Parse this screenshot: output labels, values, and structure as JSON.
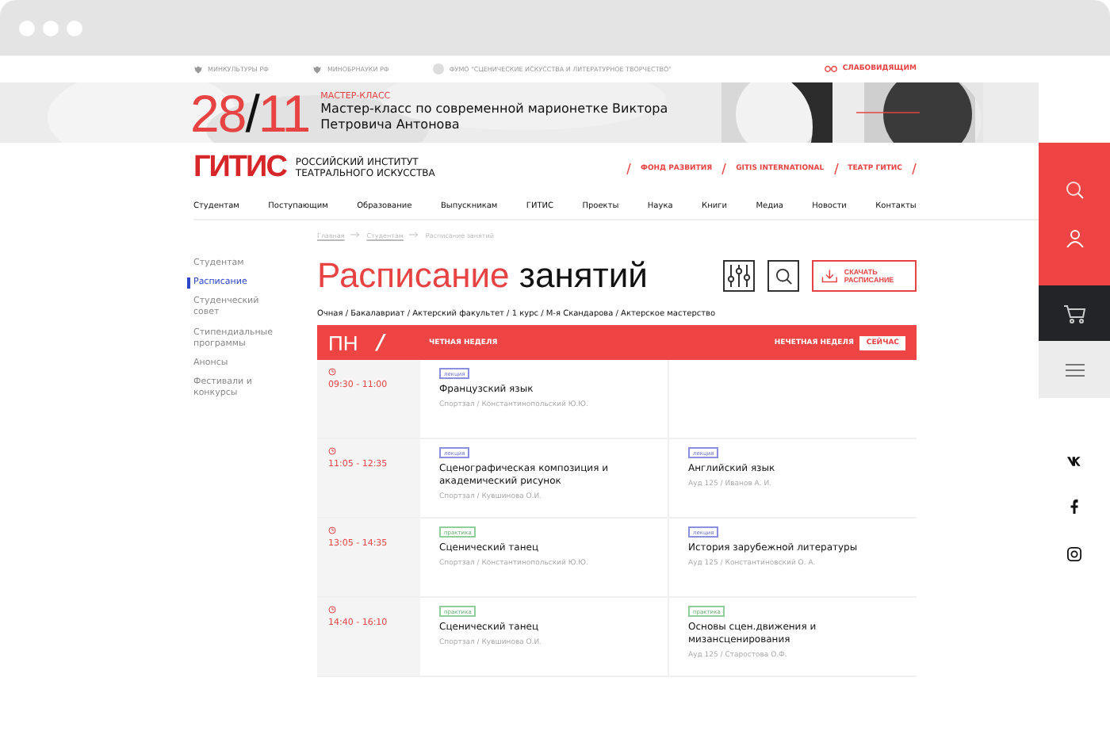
{
  "top_links": [
    "МИНКУЛЬТУРЫ РФ",
    "МИНОБРНАУКИ РФ",
    "ФУМО \"СЦЕНИЧЕСКИЕ ИСКУССТВА И ЛИТЕРАТУРНОЕ ТВОРЧЕСТВО\""
  ],
  "accessibility_link": "СЛАБОВИДЯЩИМ",
  "banner": {
    "day": "28",
    "slash": "/",
    "month": "11",
    "kicker": "МАСТЕР-КЛАСС",
    "title": "Мастер-класс по современной марионетке Виктора Петровича Антонова"
  },
  "logo": {
    "mark": "ГИТИС",
    "name": "РОССИЙСКИЙ ИНСТИТУТ ТЕАТРАЛЬНОГО ИСКУССТВА"
  },
  "header_links": [
    "ФОНД РАЗВИТИЯ",
    "GITIS INTERNATIONAL",
    "ТЕАТР ГИТИС"
  ],
  "nav": [
    "Студентам",
    "Поступающим",
    "Образование",
    "Выпускникам",
    "ГИТИС",
    "Проекты",
    "Наука",
    "Книги",
    "Медиа",
    "Новости",
    "Контакты"
  ],
  "breadcrumbs": [
    "Главная",
    "Студентам",
    "Расписание занятий"
  ],
  "sidebar": [
    {
      "label": "Студентам",
      "selected": false
    },
    {
      "label": "Расписание",
      "selected": true
    },
    {
      "label": "Студенческий совет",
      "selected": false
    },
    {
      "label": "Стипендиальные программы",
      "selected": false
    },
    {
      "label": "Анонсы",
      "selected": false
    },
    {
      "label": "Фестивали и конкурсы",
      "selected": false
    }
  ],
  "title": {
    "accent": "Расписание",
    "rest": "занятий"
  },
  "download_button": "СКАЧАТЬ РАСПИСАНИЕ",
  "filter_path": "Очная / Бакалавриат / Актерский факультет / 1 курс / М-я Скандарова / Актерское мастерство",
  "day_bar": {
    "day": "ПН",
    "slash": "/",
    "even_week": "ЧЕТНАЯ НЕДЕЛЯ",
    "odd_week": "НЕЧЕТНАЯ НЕДЕЛЯ",
    "now_badge": "СЕЙЧАС"
  },
  "rows": [
    {
      "time": "09:30 - 11:00",
      "even": {
        "kind": "lecture",
        "tag": "лекция",
        "title": "Французский язык",
        "meta": "Спортзал / Константинопольский Ю.Ю."
      }
    },
    {
      "time": "11:05 - 12:35",
      "even": {
        "kind": "lecture",
        "tag": "лекция",
        "title": "Сценографическая композиция и академический рисунок",
        "meta": "Спортзал / Кувшинова О.И."
      },
      "odd": {
        "kind": "lecture",
        "tag": "лекция",
        "title": "Английский язык",
        "meta": "Ауд 125 / Иванов А. И."
      }
    },
    {
      "time": "13:05 - 14:35",
      "even": {
        "kind": "practice",
        "tag": "практика",
        "title": "Сценический  танец",
        "meta": "Спортзал / Константинопольский Ю.Ю."
      },
      "odd": {
        "kind": "lecture",
        "tag": "лекция",
        "title": "История зарубежной литературы",
        "meta": "Ауд 125 / Константиновский О. А."
      }
    },
    {
      "time": "14:40 - 16:10",
      "even": {
        "kind": "practice",
        "tag": "практика",
        "title": "Сценический  танец",
        "meta": "Спортзал / Кувшинова О.И."
      },
      "odd": {
        "kind": "practice",
        "tag": "практика",
        "title": "Основы сцен.движения и мизансценирования",
        "meta": "Ауд 125 / Старостова О.Ф."
      }
    }
  ]
}
